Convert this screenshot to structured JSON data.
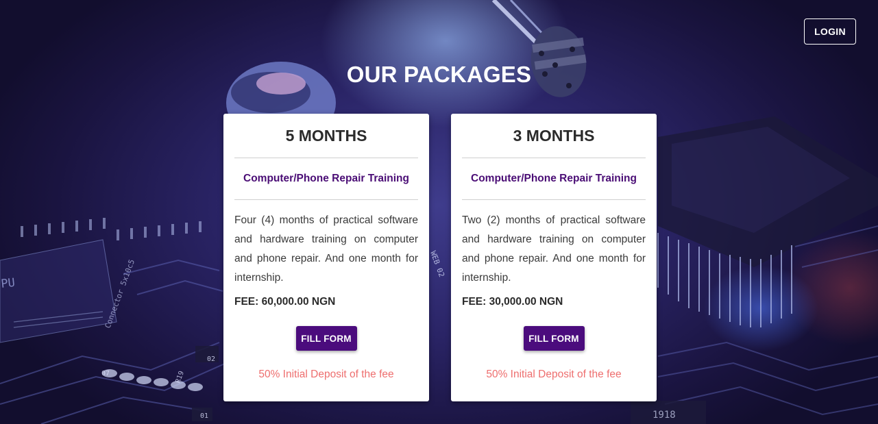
{
  "header": {
    "login_label": "LOGIN"
  },
  "page": {
    "title": "OUR PACKAGES"
  },
  "packages": [
    {
      "duration": "5 MONTHS",
      "course": "Computer/Phone Repair Training",
      "description": "Four (4) months of practical software and hardware training on computer and phone repair. And one month for internship.",
      "fee": "FEE: 60,000.00 NGN",
      "button_label": "FILL FORM",
      "deposit_note": "50% Initial Deposit of the fee"
    },
    {
      "duration": "3 MONTHS",
      "course": "Computer/Phone Repair Training",
      "description": "Two (2) months of practical software and hardware training on computer and phone repair. And one month for internship.",
      "fee": "FEE: 30,000.00 NGN",
      "button_label": "FILL FORM",
      "deposit_note": "50% Initial Deposit of the fee"
    }
  ],
  "background": {
    "circuit_labels": [
      "PU",
      "Connector 5x10c5",
      "07",
      "02",
      "01",
      "R19",
      "WEB 02",
      "1918"
    ]
  },
  "colors": {
    "accent": "#4b0c7d",
    "course_text": "#4a0d75",
    "deposit_text": "#ee6e6e",
    "card_bg": "#ffffff"
  }
}
